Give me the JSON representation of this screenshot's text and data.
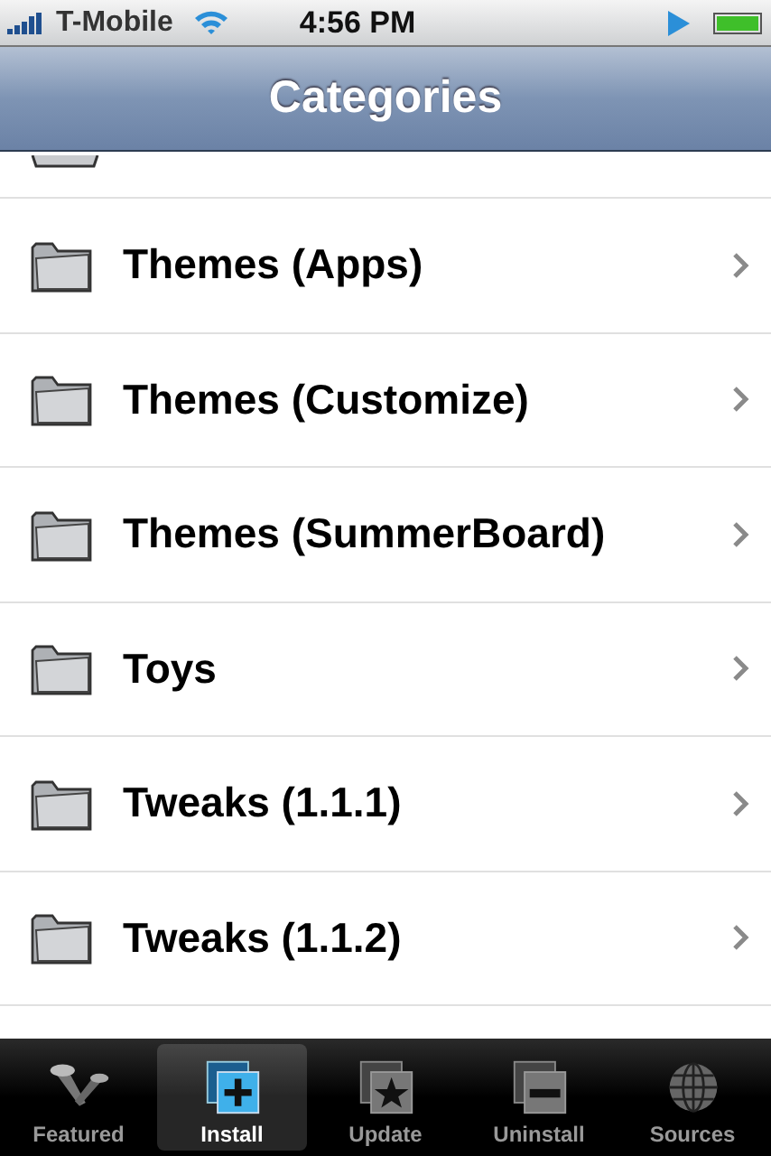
{
  "status_bar": {
    "carrier": "T-Mobile",
    "time": "4:56 PM"
  },
  "nav_bar": {
    "title": "Categories"
  },
  "categories": [
    {
      "label": "Themes (Apps)"
    },
    {
      "label": "Themes (Customize)"
    },
    {
      "label": "Themes (SummerBoard)"
    },
    {
      "label": "Toys"
    },
    {
      "label": "Tweaks (1.1.1)"
    },
    {
      "label": "Tweaks (1.1.2)"
    }
  ],
  "tabs": [
    {
      "label": "Featured",
      "kind": "featured",
      "selected": false
    },
    {
      "label": "Install",
      "kind": "install",
      "selected": true
    },
    {
      "label": "Update",
      "kind": "update",
      "selected": false
    },
    {
      "label": "Uninstall",
      "kind": "uninstall",
      "selected": false
    },
    {
      "label": "Sources",
      "kind": "sources",
      "selected": false
    }
  ]
}
